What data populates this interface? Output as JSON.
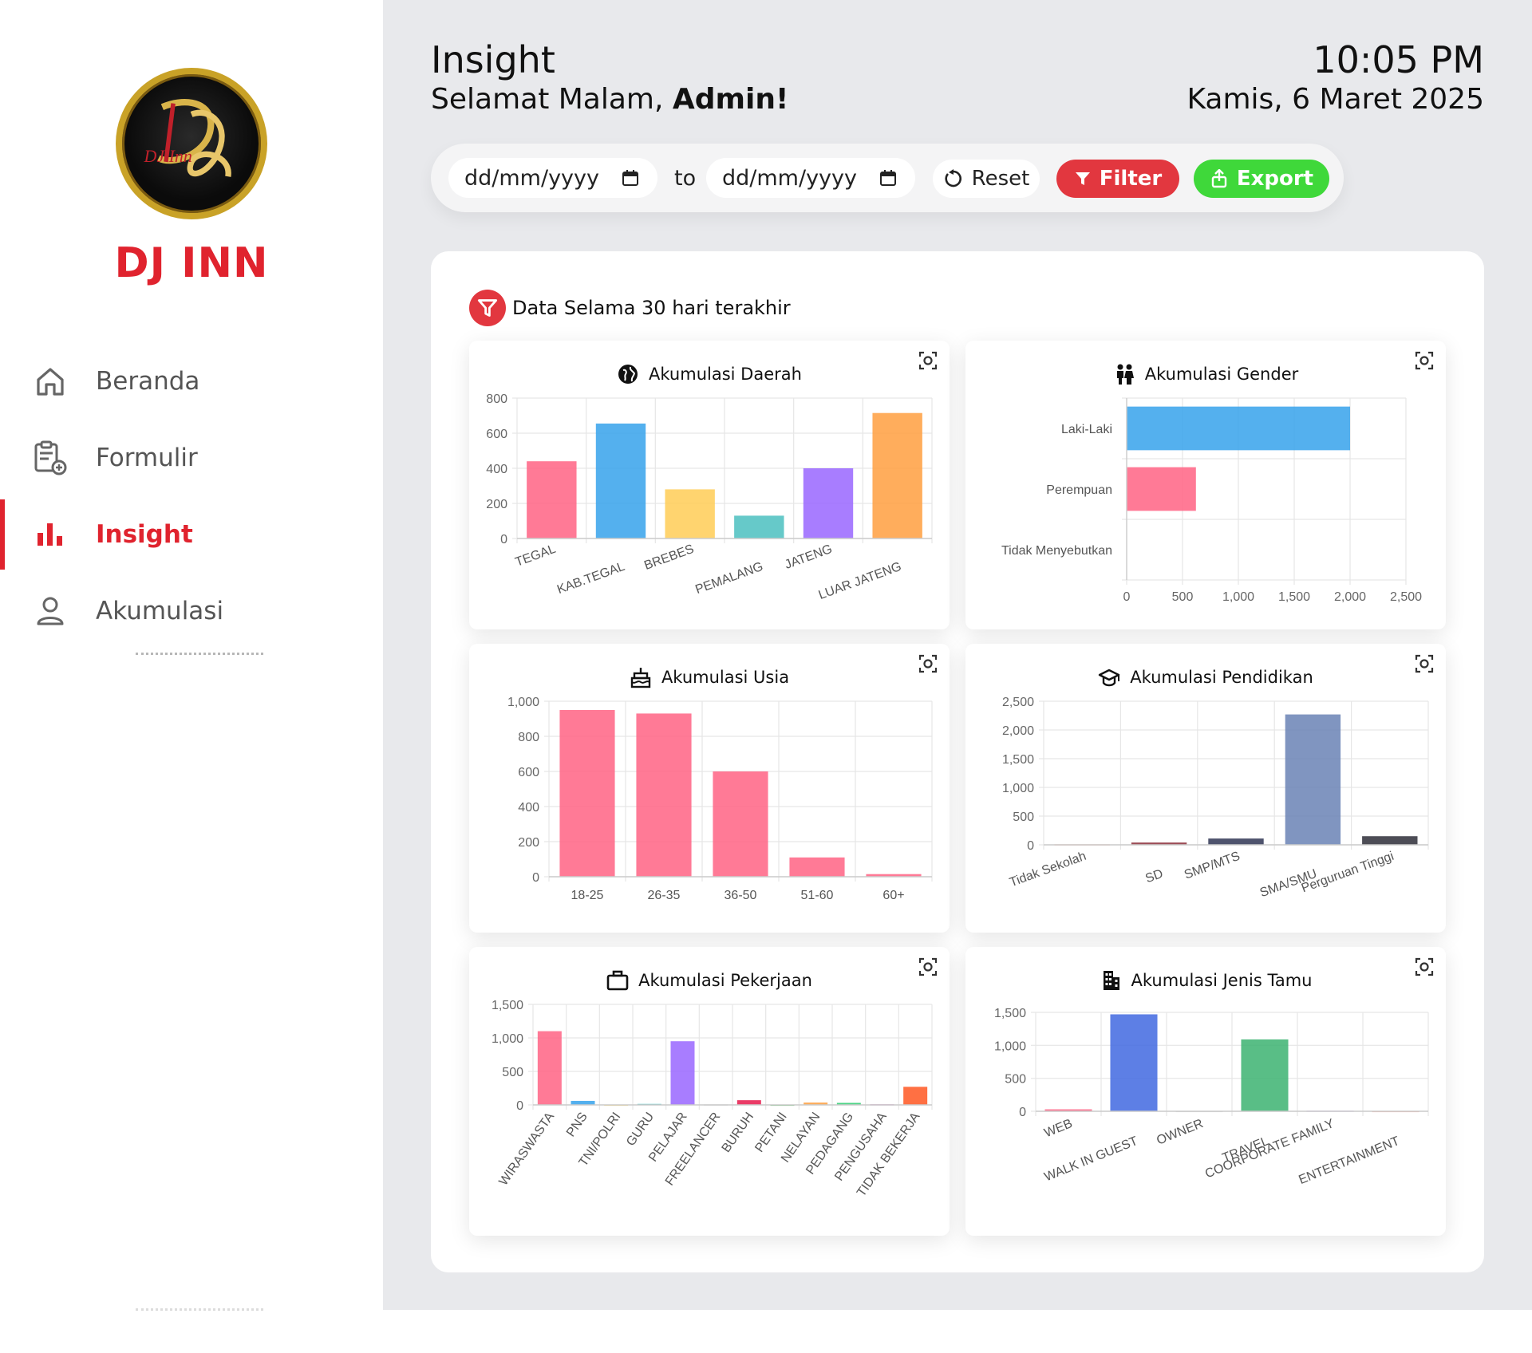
{
  "sidebar": {
    "brand": "DJ INN",
    "logo_text": "DJ Inn",
    "items": [
      {
        "label": "Beranda",
        "icon": "home-icon"
      },
      {
        "label": "Formulir",
        "icon": "form-add-icon"
      },
      {
        "label": "Insight",
        "icon": "bar-chart-icon",
        "active": true
      },
      {
        "label": "Akumulasi",
        "icon": "user-icon"
      }
    ]
  },
  "header": {
    "title": "Insight",
    "greeting_prefix": "Selamat Malam, ",
    "greeting_name": "Admin!",
    "time": "10:05 PM",
    "date": "Kamis, 6 Maret 2025"
  },
  "filters": {
    "from_placeholder": "dd/mm/yyyy",
    "to_label": "to",
    "to_placeholder": "dd/mm/yyyy",
    "reset_label": "Reset",
    "filter_label": "Filter",
    "export_label": "Export"
  },
  "colors": {
    "accent": "#e0232e",
    "filter": "#e2373f",
    "export": "#3fd83a"
  },
  "panel": {
    "note": "Data Selama 30 hari terakhir"
  },
  "chart_data": [
    {
      "id": "daerah",
      "type": "bar",
      "title": "Akumulasi Daerah",
      "icon": "globe-icon",
      "categories": [
        "TEGAL",
        "KAB.TEGAL",
        "BREBES",
        "PEMALANG",
        "JATENG",
        "LUAR JATENG"
      ],
      "values": [
        440,
        655,
        280,
        130,
        400,
        715
      ],
      "colors": [
        "#ff6384",
        "#36a2eb",
        "#ffcd56",
        "#4bc0c0",
        "#9966ff",
        "#ff9f40"
      ],
      "ylim": [
        0,
        800
      ],
      "yticks": [
        0,
        200,
        400,
        600,
        800
      ],
      "ytick_labels": [
        "0",
        "200",
        "400",
        "600",
        "800"
      ]
    },
    {
      "id": "gender",
      "type": "bar",
      "orientation": "horizontal",
      "title": "Akumulasi Gender",
      "icon": "people-icon",
      "categories": [
        "Laki-Laki",
        "Perempuan",
        "Tidak Menyebutkan"
      ],
      "values": [
        2000,
        620,
        0
      ],
      "colors": [
        "#36a2eb",
        "#ff6384",
        "#ffcd56"
      ],
      "xlim": [
        0,
        2500
      ],
      "xticks": [
        0,
        500,
        1000,
        1500,
        2000,
        2500
      ],
      "xtick_labels": [
        "0",
        "500",
        "1,000",
        "1,500",
        "2,000",
        "2,500"
      ]
    },
    {
      "id": "usia",
      "type": "bar",
      "title": "Akumulasi Usia",
      "icon": "cake-icon",
      "categories": [
        "18-25",
        "26-35",
        "36-50",
        "51-60",
        "60+"
      ],
      "values": [
        950,
        930,
        600,
        110,
        15
      ],
      "colors": [
        "#ff6384",
        "#ff6384",
        "#ff6384",
        "#ff6384",
        "#ff6384"
      ],
      "ylim": [
        0,
        1000
      ],
      "yticks": [
        0,
        200,
        400,
        600,
        800,
        1000
      ],
      "ytick_labels": [
        "0",
        "200",
        "400",
        "600",
        "800",
        "1,000"
      ]
    },
    {
      "id": "pendidikan",
      "type": "bar",
      "title": "Akumulasi Pendidikan",
      "icon": "graduation-cap-icon",
      "categories": [
        "Tidak Sekolah",
        "SD",
        "SMP/MTS",
        "SMA/SMU",
        "Perguruan Tinggi"
      ],
      "values": [
        10,
        40,
        110,
        2270,
        150
      ],
      "colors": [
        "#f4a99b",
        "#8c2f39",
        "#2f3553",
        "#6a83b5",
        "#2e2e38"
      ],
      "ylim": [
        0,
        2500
      ],
      "yticks": [
        0,
        500,
        1000,
        1500,
        2000,
        2500
      ],
      "ytick_labels": [
        "0",
        "500",
        "1,000",
        "1,500",
        "2,000",
        "2,500"
      ]
    },
    {
      "id": "pekerjaan",
      "type": "bar",
      "title": "Akumulasi Pekerjaan",
      "icon": "briefcase-icon",
      "categories": [
        "WIRASWASTA",
        "PNS",
        "TNI/POLRI",
        "GURU",
        "PELAJAR",
        "FREELANCER",
        "BURUH",
        "PETANI",
        "NELAYAN",
        "PEDAGANG",
        "PENGUSAHA",
        "TIDAK BEKERJA"
      ],
      "values": [
        1100,
        60,
        5,
        15,
        950,
        8,
        70,
        5,
        35,
        30,
        10,
        270
      ],
      "colors": [
        "#ff6384",
        "#36a2eb",
        "#ffcd56",
        "#4bc0c0",
        "#9966ff",
        "#c9cbcf",
        "#e6194b",
        "#3cb44b",
        "#ff9f40",
        "#2ecc71",
        "#c77dbd",
        "#ff5722"
      ],
      "ylim": [
        0,
        1500
      ],
      "yticks": [
        0,
        500,
        1000,
        1500
      ],
      "ytick_labels": [
        "0",
        "500",
        "1,000",
        "1,500"
      ]
    },
    {
      "id": "jenis_tamu",
      "type": "bar",
      "title": "Akumulasi Jenis Tamu",
      "icon": "building-icon",
      "categories": [
        "WEB",
        "WALK IN GUEST",
        "OWNER",
        "TRAVEL",
        "COORPORATE FAMILY",
        "ENTERTAINMENT"
      ],
      "values": [
        30,
        1470,
        5,
        1090,
        10,
        5
      ],
      "colors": [
        "#ff6384",
        "#4169e1",
        "#d9d9d9",
        "#3cb371",
        "#c9b3e6",
        "#f4a99b"
      ],
      "ylim": [
        0,
        1500
      ],
      "yticks": [
        0,
        500,
        1000,
        1500
      ],
      "ytick_labels": [
        "0",
        "500",
        "1,000",
        "1,500"
      ]
    }
  ]
}
